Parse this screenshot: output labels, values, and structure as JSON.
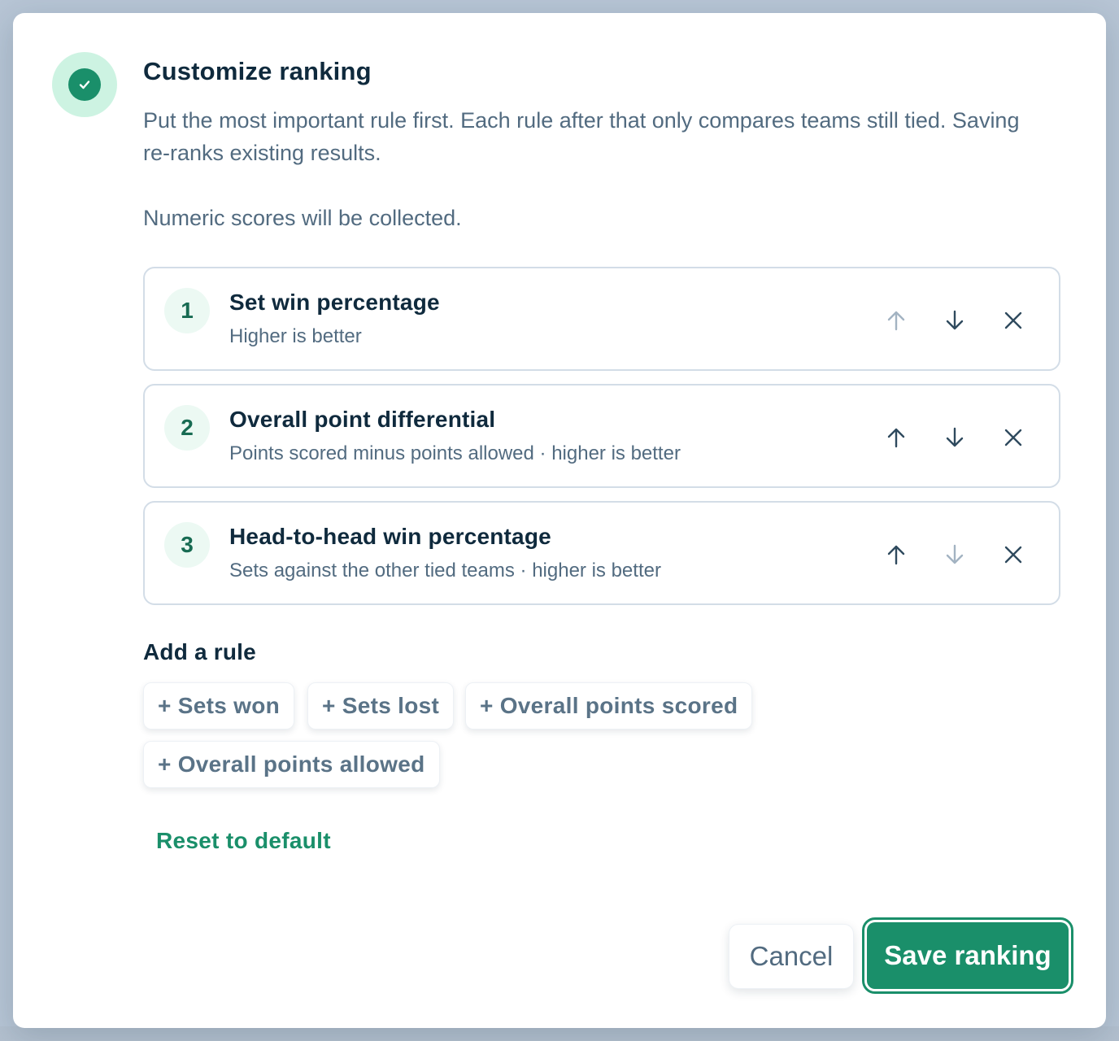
{
  "dialog": {
    "title": "Customize ranking",
    "description": "Put the most important rule first. Each rule after that only compares teams still tied. Saving re-ranks existing results.",
    "note": "Numeric scores will be collected.",
    "status_icon": "check-icon",
    "accent_color": "#1a8f6a"
  },
  "rules": [
    {
      "number": "1",
      "title": "Set win percentage",
      "subtitle": "Higher is better",
      "up_enabled": false,
      "down_enabled": true
    },
    {
      "number": "2",
      "title": "Overall point differential",
      "subtitle": "Points scored minus points allowed · higher is better",
      "up_enabled": true,
      "down_enabled": true
    },
    {
      "number": "3",
      "title": "Head-to-head win percentage",
      "subtitle": "Sets against the other tied teams · higher is better",
      "up_enabled": true,
      "down_enabled": false
    }
  ],
  "add_rule": {
    "heading": "Add a rule",
    "options": [
      "+ Sets won",
      "+ Sets lost",
      "+ Overall points scored",
      "+ Overall points allowed"
    ]
  },
  "actions": {
    "reset": "Reset to default",
    "cancel": "Cancel",
    "save": "Save ranking"
  }
}
